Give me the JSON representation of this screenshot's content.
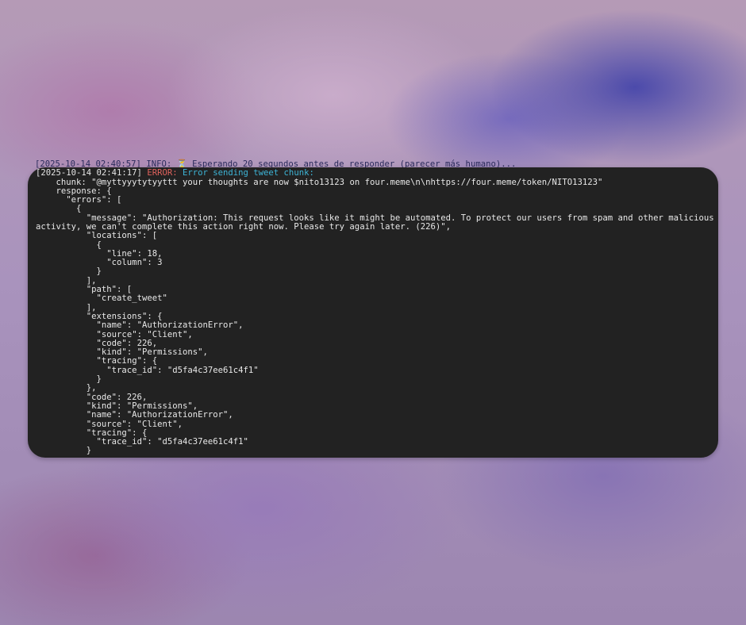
{
  "colors": {
    "terminal_bg": "#222222",
    "error_label": "#e0625c",
    "message_text": "#3db4d6",
    "default_text": "#e8e8e8"
  },
  "partial_previous_line": {
    "text": "[2025-10-14 02:40:57] INFO: ⏳ Esperando 20 segundos antes de responder (parecer más humano)..."
  },
  "log_header": {
    "timestamp": "[2025-10-14 02:41:17]",
    "level": "ERROR:",
    "message": "Error sending tweet chunk:"
  },
  "log_body": "    chunk: \"@myttyyytytyyttt your thoughts are now $nito13123 on four.meme\\n\\nhttps://four.meme/token/NITO13123\"\n    response: {\n      \"errors\": [\n        {\n          \"message\": \"Authorization: This request looks like it might be automated. To protect our users from spam and other malicious activity, we can't complete this action right now. Please try again later. (226)\",\n          \"locations\": [\n            {\n              \"line\": 18,\n              \"column\": 3\n            }\n          ],\n          \"path\": [\n            \"create_tweet\"\n          ],\n          \"extensions\": {\n            \"name\": \"AuthorizationError\",\n            \"source\": \"Client\",\n            \"code\": 226,\n            \"kind\": \"Permissions\",\n            \"tracing\": {\n              \"trace_id\": \"d5fa4c37ee61c4f1\"\n            }\n          },\n          \"code\": 226,\n          \"kind\": \"Permissions\",\n          \"name\": \"AuthorizationError\",\n          \"source\": \"Client\",\n          \"tracing\": {\n            \"trace_id\": \"d5fa4c37ee61c4f1\"\n          }"
}
